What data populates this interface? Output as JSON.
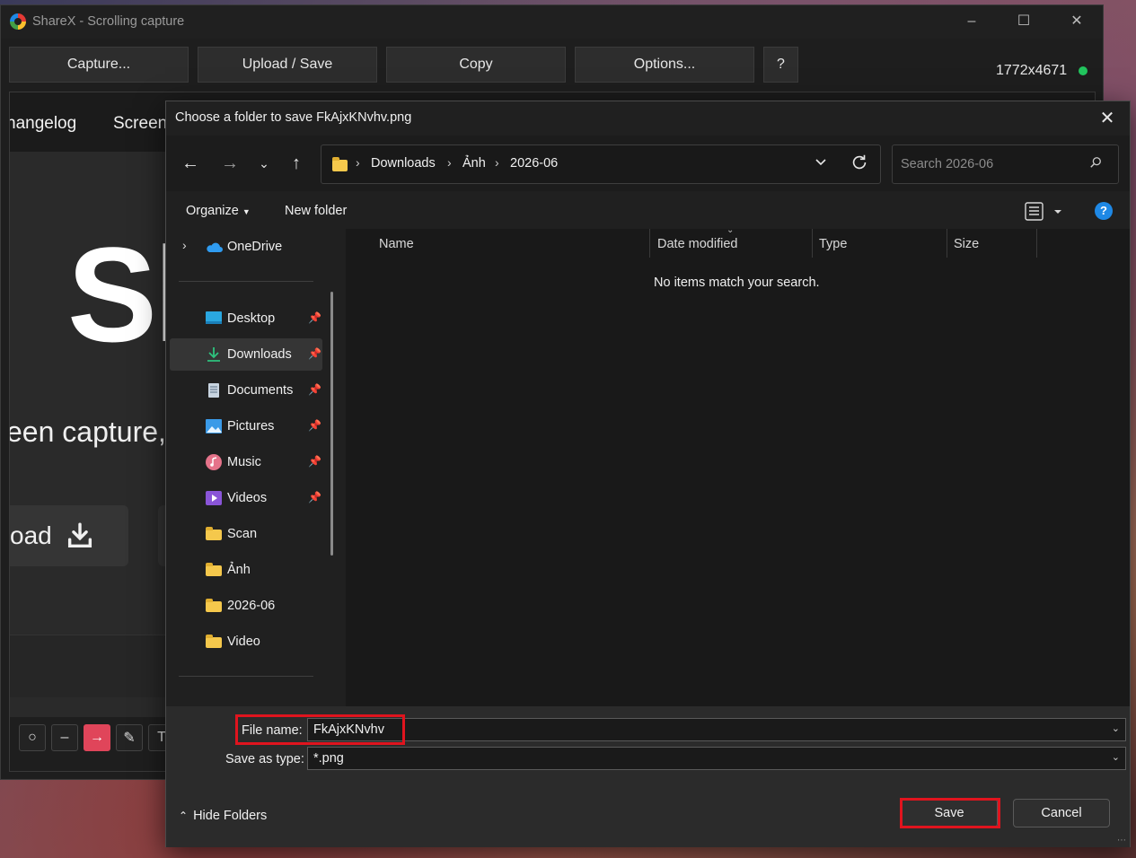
{
  "sharex": {
    "title": "ShareX - Scrolling capture",
    "toolbar": {
      "capture": "Capture...",
      "upload_save": "Upload / Save",
      "copy": "Copy",
      "options": "Options...",
      "help": "?"
    },
    "dimensions": "1772x4671",
    "status_color": "#22c55e",
    "preview": {
      "nav_changelog": "hangelog",
      "nav_screens": "Screens",
      "hero_text": "Sh",
      "tagline": "een capture,",
      "download_label": "oad"
    }
  },
  "dialog": {
    "title": "Choose a folder to save FkAjxKNvhv.png",
    "breadcrumb": [
      "Downloads",
      "Ảnh",
      "2026-06"
    ],
    "search_placeholder": "Search 2026-06",
    "organize": "Organize",
    "new_folder": "New folder",
    "help": "?",
    "nav_pane": {
      "onedrive": "OneDrive",
      "quick_access": [
        {
          "label": "Desktop",
          "icon": "desktop-icon",
          "pinned": true
        },
        {
          "label": "Downloads",
          "icon": "downloads-icon",
          "pinned": true,
          "selected": true
        },
        {
          "label": "Documents",
          "icon": "documents-icon",
          "pinned": true
        },
        {
          "label": "Pictures",
          "icon": "pictures-icon",
          "pinned": true
        },
        {
          "label": "Music",
          "icon": "music-icon",
          "pinned": true
        },
        {
          "label": "Videos",
          "icon": "videos-icon",
          "pinned": true
        },
        {
          "label": "Scan",
          "icon": "folder-icon",
          "pinned": false
        },
        {
          "label": "Ảnh",
          "icon": "folder-icon",
          "pinned": false
        },
        {
          "label": "2026-06",
          "icon": "folder-icon",
          "pinned": false
        },
        {
          "label": "Video",
          "icon": "folder-icon",
          "pinned": false
        }
      ]
    },
    "columns": [
      "Name",
      "Date modified",
      "Type",
      "Size"
    ],
    "empty_message": "No items match your search.",
    "file_name_label": "File name:",
    "file_name_value": "FkAjxKNvhv",
    "save_type_label": "Save as type:",
    "save_type_value": "*.png",
    "hide_folders": "Hide Folders",
    "save": "Save",
    "cancel": "Cancel",
    "highlight_color": "#e0141e"
  }
}
